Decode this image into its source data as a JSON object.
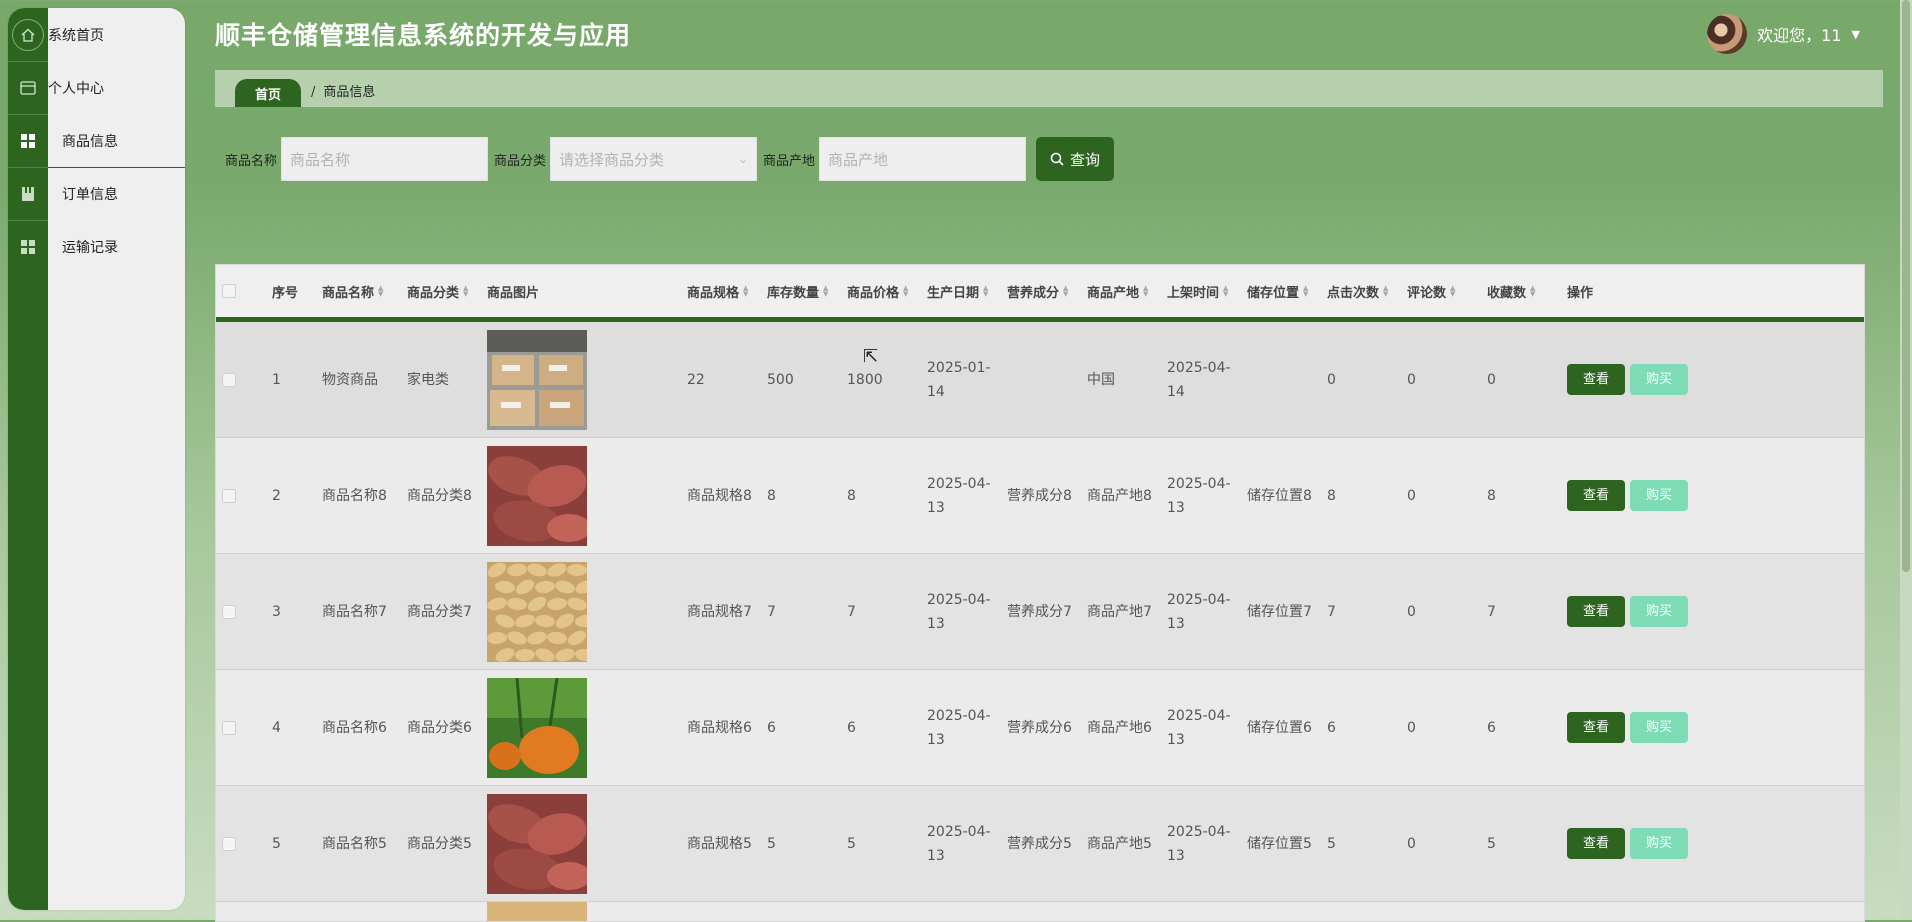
{
  "app": {
    "title": "顺丰仓储管理信息系统的开发与应用"
  },
  "user": {
    "welcome": "欢迎您，11"
  },
  "sidebar": {
    "items": [
      {
        "label": "系统首页",
        "icon": "home-icon"
      },
      {
        "label": "个人中心",
        "icon": "card-icon"
      },
      {
        "label": "商品信息",
        "icon": "grid-icon",
        "active": true
      },
      {
        "label": "订单信息",
        "icon": "bookmark-icon"
      },
      {
        "label": "运输记录",
        "icon": "grid-icon"
      }
    ]
  },
  "breadcrumb": {
    "home": "首页",
    "separator": "/",
    "current": "商品信息"
  },
  "search": {
    "name_label": "商品名称",
    "name_placeholder": "商品名称",
    "category_label": "商品分类",
    "category_placeholder": "请选择商品分类",
    "origin_label": "商品产地",
    "origin_placeholder": "商品产地",
    "button_label": "查询"
  },
  "table": {
    "headers": [
      "序号",
      "商品名称",
      "商品分类",
      "商品图片",
      "商品规格",
      "库存数量",
      "商品价格",
      "生产日期",
      "营养成分",
      "商品产地",
      "上架时间",
      "储存位置",
      "点击次数",
      "评论数",
      "收藏数",
      "操作"
    ],
    "view_label": "查看",
    "buy_label": "购买",
    "rows": [
      {
        "index": "1",
        "name": "物资商品",
        "category": "家电类",
        "image": "boxes",
        "spec": "22",
        "stock": "500",
        "price": "1800",
        "prod_date": "2025-01-14",
        "nutrition": "",
        "origin": "中国",
        "shelf_time": "2025-04-14",
        "location": "",
        "clicks": "0",
        "comments": "0",
        "favorites": "0"
      },
      {
        "index": "2",
        "name": "商品名称8",
        "category": "商品分类8",
        "image": "sweet-potato",
        "spec": "商品规格8",
        "stock": "8",
        "price": "8",
        "prod_date": "2025-04-13",
        "nutrition": "营养成分8",
        "origin": "商品产地8",
        "shelf_time": "2025-04-13",
        "location": "储存位置8",
        "clicks": "8",
        "comments": "0",
        "favorites": "8"
      },
      {
        "index": "3",
        "name": "商品名称7",
        "category": "商品分类7",
        "image": "peanuts",
        "spec": "商品规格7",
        "stock": "7",
        "price": "7",
        "prod_date": "2025-04-13",
        "nutrition": "营养成分7",
        "origin": "商品产地7",
        "shelf_time": "2025-04-13",
        "location": "储存位置7",
        "clicks": "7",
        "comments": "0",
        "favorites": "7"
      },
      {
        "index": "4",
        "name": "商品名称6",
        "category": "商品分类6",
        "image": "pumpkin",
        "spec": "商品规格6",
        "stock": "6",
        "price": "6",
        "prod_date": "2025-04-13",
        "nutrition": "营养成分6",
        "origin": "商品产地6",
        "shelf_time": "2025-04-13",
        "location": "储存位置6",
        "clicks": "6",
        "comments": "0",
        "favorites": "6"
      },
      {
        "index": "5",
        "name": "商品名称5",
        "category": "商品分类5",
        "image": "sweet-potato",
        "spec": "商品规格5",
        "stock": "5",
        "price": "5",
        "prod_date": "2025-04-13",
        "nutrition": "营养成分5",
        "origin": "商品产地5",
        "shelf_time": "2025-04-13",
        "location": "储存位置5",
        "clicks": "5",
        "comments": "0",
        "favorites": "5"
      }
    ]
  },
  "colors": {
    "accent": "#2c6420",
    "buy_button": "#7ddcb6",
    "header_bg": "#79a96c"
  }
}
